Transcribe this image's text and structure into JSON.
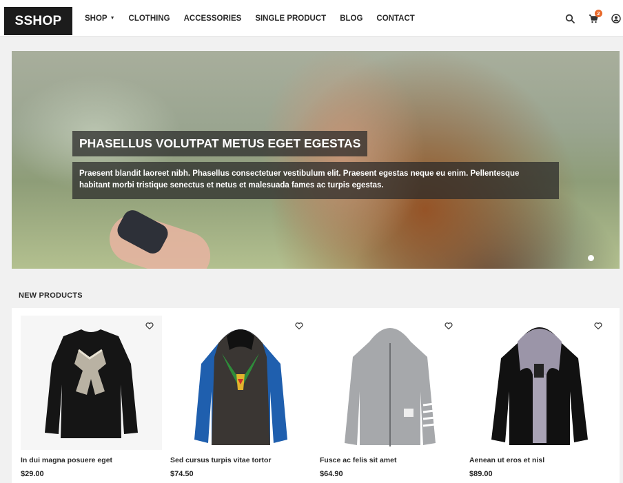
{
  "header": {
    "logo": "SSHOP",
    "nav": [
      {
        "label": "SHOP",
        "has_dropdown": true
      },
      {
        "label": "CLOTHING"
      },
      {
        "label": "ACCESSORIES"
      },
      {
        "label": "SINGLE PRODUCT"
      },
      {
        "label": "BLOG"
      },
      {
        "label": "CONTACT"
      }
    ],
    "cart_count": "2",
    "icons": [
      "search-icon",
      "cart-icon",
      "user-icon"
    ]
  },
  "hero": {
    "title": "PHASELLUS VOLUTPAT METUS EGET EGESTAS",
    "description": "Praesent blandit laoreet nibh. Phasellus consectetuer vestibulum elit. Praesent egestas neque eu enim. Pellentesque habitant morbi tristique senectus et netus et malesuada fames ac turpis egestas."
  },
  "section": {
    "title": "NEW PRODUCTS"
  },
  "products": [
    {
      "name": "In dui magna posuere eget",
      "price": "$29.00"
    },
    {
      "name": "Sed cursus turpis vitae tortor",
      "price": "$74.50"
    },
    {
      "name": "Fusce ac felis sit amet",
      "price": "$64.90"
    },
    {
      "name": "Aenean ut eros et nisl",
      "price": "$89.00"
    }
  ],
  "colors": {
    "accent": "#e8692b",
    "logo_bg": "#1c1c1c"
  }
}
